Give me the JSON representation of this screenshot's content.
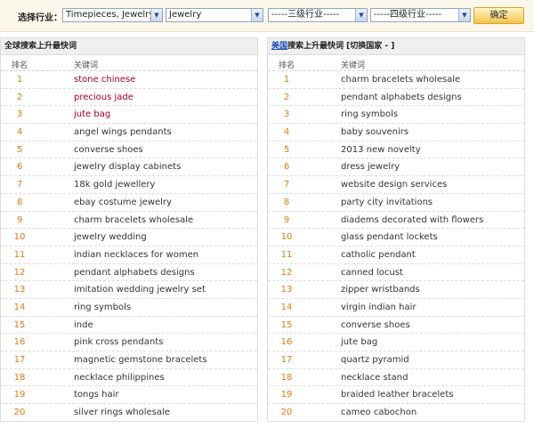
{
  "filter": {
    "label": "选择行业：",
    "select1": "Timepieces, Jewelry",
    "select2": "Jewelry",
    "select3": "-----三级行业-----",
    "select4": "-----四级行业-----",
    "button": "确定"
  },
  "left_panel": {
    "title": "全球搜索上升最快词",
    "col_rank": "排名",
    "col_keyword": "关键词",
    "rows": [
      {
        "rank": "1",
        "keyword": "stone chinese",
        "hot": true
      },
      {
        "rank": "2",
        "keyword": "precious jade",
        "hot": true
      },
      {
        "rank": "3",
        "keyword": "jute bag",
        "hot": true
      },
      {
        "rank": "4",
        "keyword": "angel wings pendants"
      },
      {
        "rank": "5",
        "keyword": "converse shoes"
      },
      {
        "rank": "6",
        "keyword": "jewelry display cabinets"
      },
      {
        "rank": "7",
        "keyword": "18k gold jewellery"
      },
      {
        "rank": "8",
        "keyword": "ebay costume jewelry"
      },
      {
        "rank": "9",
        "keyword": "charm bracelets wholesale"
      },
      {
        "rank": "10",
        "keyword": "jewelry wedding"
      },
      {
        "rank": "11",
        "keyword": "indian necklaces for women"
      },
      {
        "rank": "12",
        "keyword": "pendant alphabets designs"
      },
      {
        "rank": "13",
        "keyword": "imitation wedding jewelry set"
      },
      {
        "rank": "14",
        "keyword": "ring symbols"
      },
      {
        "rank": "15",
        "keyword": "inde"
      },
      {
        "rank": "16",
        "keyword": "pink cross pendants"
      },
      {
        "rank": "17",
        "keyword": "magnetic gemstone bracelets"
      },
      {
        "rank": "18",
        "keyword": "necklace philippines"
      },
      {
        "rank": "19",
        "keyword": "tongs hair"
      },
      {
        "rank": "20",
        "keyword": "silver rings wholesale"
      }
    ]
  },
  "right_panel": {
    "country": "美国",
    "title": "搜索上升最快词",
    "switch_label": "[切换国家 - ]",
    "col_rank": "排名",
    "col_keyword": "关键词",
    "rows": [
      {
        "rank": "1",
        "keyword": "charm bracelets wholesale"
      },
      {
        "rank": "2",
        "keyword": "pendant alphabets designs"
      },
      {
        "rank": "3",
        "keyword": "ring symbols"
      },
      {
        "rank": "4",
        "keyword": "baby souvenirs"
      },
      {
        "rank": "5",
        "keyword": "2013 new novelty"
      },
      {
        "rank": "6",
        "keyword": "dress jewelry"
      },
      {
        "rank": "7",
        "keyword": "website design services"
      },
      {
        "rank": "8",
        "keyword": "party city invitations"
      },
      {
        "rank": "9",
        "keyword": "diadems decorated with flowers"
      },
      {
        "rank": "10",
        "keyword": "glass pendant lockets"
      },
      {
        "rank": "11",
        "keyword": "catholic pendant"
      },
      {
        "rank": "12",
        "keyword": "canned locust"
      },
      {
        "rank": "13",
        "keyword": "zipper wristbands"
      },
      {
        "rank": "14",
        "keyword": "virgin indian hair"
      },
      {
        "rank": "15",
        "keyword": "converse shoes"
      },
      {
        "rank": "16",
        "keyword": "jute bag"
      },
      {
        "rank": "17",
        "keyword": "quartz pyramid"
      },
      {
        "rank": "18",
        "keyword": "necklace stand"
      },
      {
        "rank": "19",
        "keyword": "braided leather bracelets"
      },
      {
        "rank": "20",
        "keyword": "cameo cabochon"
      }
    ]
  }
}
